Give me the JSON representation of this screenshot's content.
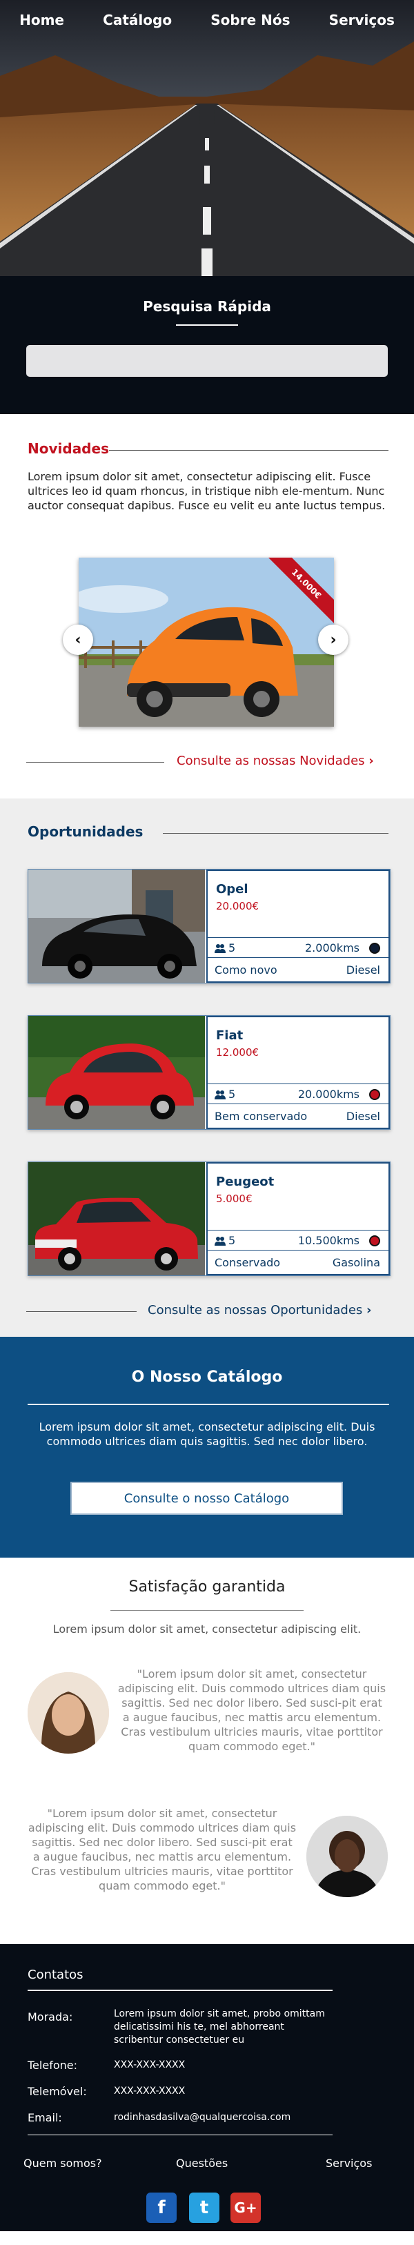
{
  "nav": {
    "items": [
      "Home",
      "Catálogo",
      "Sobre Nós",
      "Serviços"
    ]
  },
  "search": {
    "title": "Pesquisa Rápida",
    "placeholder": ""
  },
  "novidades": {
    "title": "Novidades",
    "text": "Lorem ipsum dolor sit amet, consectetur adipiscing elit. Fusce ultrices leo id quam rhoncus, in tristique nibh ele-mentum. Nunc auctor consequat dapibus. Fusce eu velit eu ante luctus tempus.",
    "ribbon": "14.000€",
    "link": "Consulte as nossas Novidades"
  },
  "oportunidades": {
    "title": "Oportunidades",
    "cards": [
      {
        "brand": "Opel",
        "price": "20.000€",
        "seats": "5",
        "kms": "2.000kms",
        "condition": "Como novo",
        "fuel": "Diesel",
        "dot_color": "#0d1b33"
      },
      {
        "brand": "Fiat",
        "price": "12.000€",
        "seats": "5",
        "kms": "20.000kms",
        "condition": "Bem conservado",
        "fuel": "Diesel",
        "dot_color": "#c1121f"
      },
      {
        "brand": "Peugeot",
        "price": "5.000€",
        "seats": "5",
        "kms": "10.500kms",
        "condition": "Conservado",
        "fuel": "Gasolina",
        "dot_color": "#c1121f"
      }
    ],
    "link": "Consulte as nossas Oportunidades"
  },
  "catalogo": {
    "title": "O Nosso Catálogo",
    "text": "Lorem ipsum dolor sit amet, consectetur adipiscing elit. Duis commodo ultrices diam quis sagittis. Sed nec dolor libero.",
    "button": "Consulte o nosso Catálogo"
  },
  "satisfacao": {
    "title": "Satisfação garantida",
    "subtitle": "Lorem ipsum dolor sit amet, consectetur adipiscing elit.",
    "quote1": "\"Lorem ipsum dolor sit amet, consectetur adipiscing elit. Duis commodo ultrices diam quis sagittis. Sed nec dolor libero. Sed susci-pit erat a augue faucibus, nec mattis arcu elementum. Cras vestibulum ultricies mauris, vitae porttitor quam commodo eget.\"",
    "quote2": "\"Lorem ipsum dolor sit amet, consectetur adipiscing elit. Duis commodo ultrices diam quis sagittis. Sed nec dolor libero. Sed susci-pit erat a augue faucibus, nec mattis arcu elementum. Cras vestibulum ultricies mauris, vitae porttitor quam commodo eget.\""
  },
  "footer": {
    "contacts_title": "Contatos",
    "morada_label": "Morada:",
    "morada_value": "Lorem ipsum dolor sit amet, probo omittam delicatissimi his te, mel abhorreant scribentur consectetuer eu",
    "telefone_label": "Telefone:",
    "telefone_value": "XXX-XXX-XXXX",
    "telemovel_label": "Telemóvel:",
    "telemovel_value": "XXX-XXX-XXXX",
    "email_label": "Email:",
    "email_value": "rodinhasdasilva@qualquercoisa.com",
    "nav": [
      "Quem somos?",
      "Questões",
      "Serviços"
    ],
    "social": {
      "facebook": "f",
      "twitter": "t",
      "google": "G+"
    }
  },
  "colors": {
    "accent_red": "#c1121f",
    "navy": "#0d3a63",
    "catalog_blue": "#0d4f83",
    "dark_bg": "#070d16"
  }
}
